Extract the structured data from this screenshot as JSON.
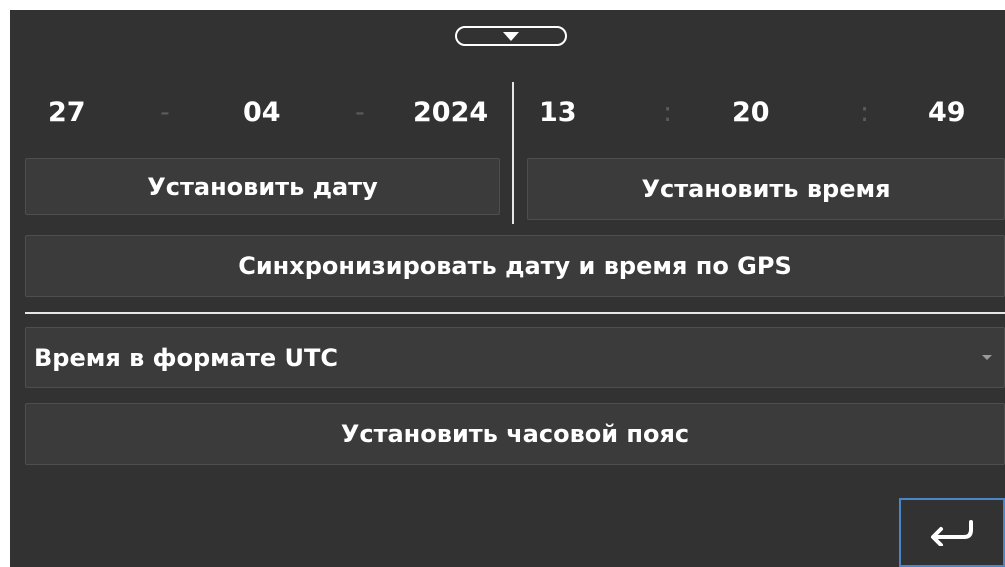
{
  "date": {
    "day": "27",
    "month": "04",
    "year": "2024",
    "separator": "-"
  },
  "time": {
    "hours": "13",
    "minutes": "20",
    "seconds": "49",
    "separator": ":"
  },
  "buttons": {
    "set_date": "Установить дату",
    "set_time": "Установить время",
    "sync_gps": "Синхронизировать дату и время по GPS",
    "set_timezone": "Установить часовой пояс"
  },
  "timezone_select": {
    "selected": "Время в формате UTC"
  },
  "icons": {
    "collapse": "triangle-down-icon",
    "back": "return-arrow-icon"
  },
  "colors": {
    "background": "#323232",
    "button": "#3b3b3b",
    "text": "#ffffff",
    "separator": "#5c5c5c",
    "accent": "#4a86c8"
  }
}
